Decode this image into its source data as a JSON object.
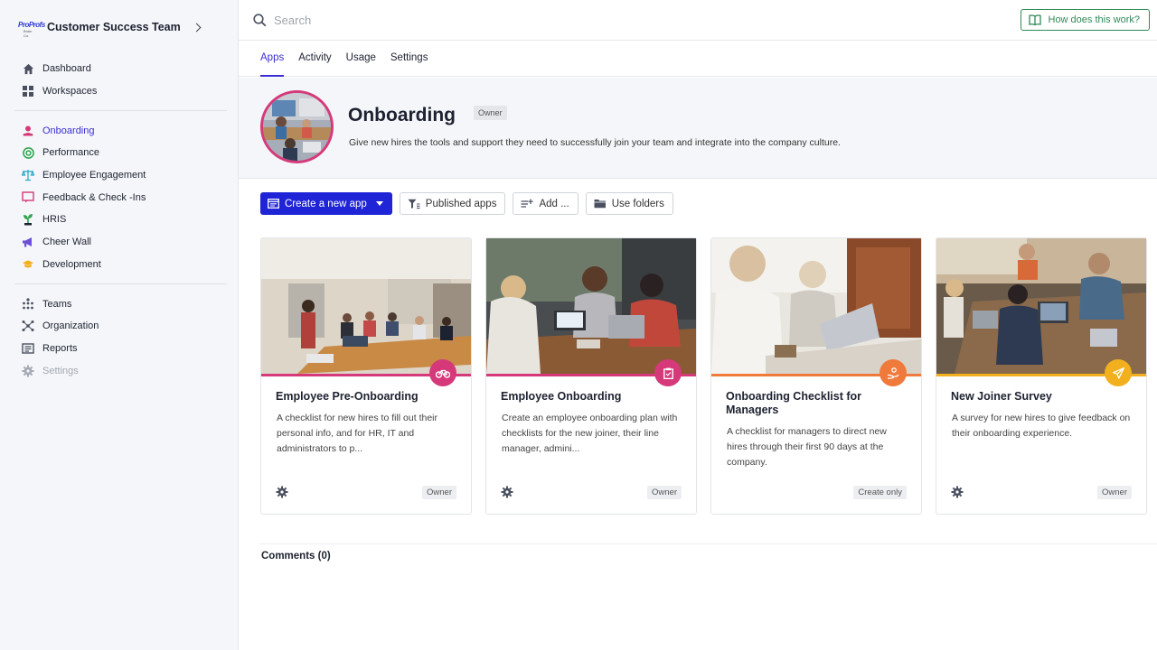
{
  "sidebar": {
    "team_name": "Customer Success Team",
    "logo_text": "ProProfs",
    "logo_subtext": "Brain Co.",
    "top_items": [
      {
        "label": "Dashboard",
        "icon": "home-icon"
      },
      {
        "label": "Workspaces",
        "icon": "grid-icon"
      }
    ],
    "workspace_items": [
      {
        "label": "Onboarding",
        "icon": "onboarding-icon",
        "color": "#d6397a",
        "active": true
      },
      {
        "label": "Performance",
        "icon": "target-icon",
        "color": "#2aa34a"
      },
      {
        "label": "Employee Engagement",
        "icon": "scale-icon",
        "color": "#26a6c9"
      },
      {
        "label": "Feedback & Check -Ins",
        "icon": "feedback-icon",
        "color": "#d6397a"
      },
      {
        "label": "HRIS",
        "icon": "plant-icon",
        "color": "#2aa34a"
      },
      {
        "label": "Cheer Wall",
        "icon": "megaphone-icon",
        "color": "#6b4fd8"
      },
      {
        "label": "Development",
        "icon": "graduation-icon",
        "color": "#f2b01e"
      }
    ],
    "admin_items": [
      {
        "label": "Teams",
        "icon": "teams-icon"
      },
      {
        "label": "Organization",
        "icon": "organization-icon"
      },
      {
        "label": "Reports",
        "icon": "reports-icon"
      },
      {
        "label": "Settings",
        "icon": "settings-icon",
        "disabled": true
      }
    ]
  },
  "topbar": {
    "search_placeholder": "Search",
    "help_label": "How does this work?"
  },
  "tabs": [
    {
      "label": "Apps",
      "active": true
    },
    {
      "label": "Activity"
    },
    {
      "label": "Usage"
    },
    {
      "label": "Settings"
    }
  ],
  "workspace": {
    "title": "Onboarding",
    "role_badge": "Owner",
    "description": "Give new hires the tools and support they need to successfully join your team and integrate into the company culture."
  },
  "toolbar": {
    "create_label": "Create a new app",
    "published_label": "Published apps",
    "add_label": "Add ...",
    "folders_label": "Use folders"
  },
  "apps": [
    {
      "title": "Employee Pre-Onboarding",
      "description": "A checklist for new hires to fill out their personal info, and for HR, IT and administrators to p...",
      "badge": "Owner",
      "accent": "#d6397a",
      "icon": "bicycle-icon"
    },
    {
      "title": "Employee Onboarding",
      "description": "Create an employee onboarding plan with checklists for the new joiner, their line manager, admini...",
      "badge": "Owner",
      "accent": "#d6397a",
      "icon": "clipboard-icon"
    },
    {
      "title": "Onboarding Checklist for Managers",
      "description": "A checklist for managers to direct new hires through their first 90 days at the company.",
      "badge": "Create only",
      "accent": "#f07a3c",
      "icon": "hand-icon"
    },
    {
      "title": "New Joiner Survey",
      "description": "A survey for new hires to give feedback on their onboarding experience.",
      "badge": "Owner",
      "accent": "#f2b01e",
      "icon": "paper-plane-icon"
    }
  ],
  "comments": {
    "label": "Comments (0)"
  }
}
